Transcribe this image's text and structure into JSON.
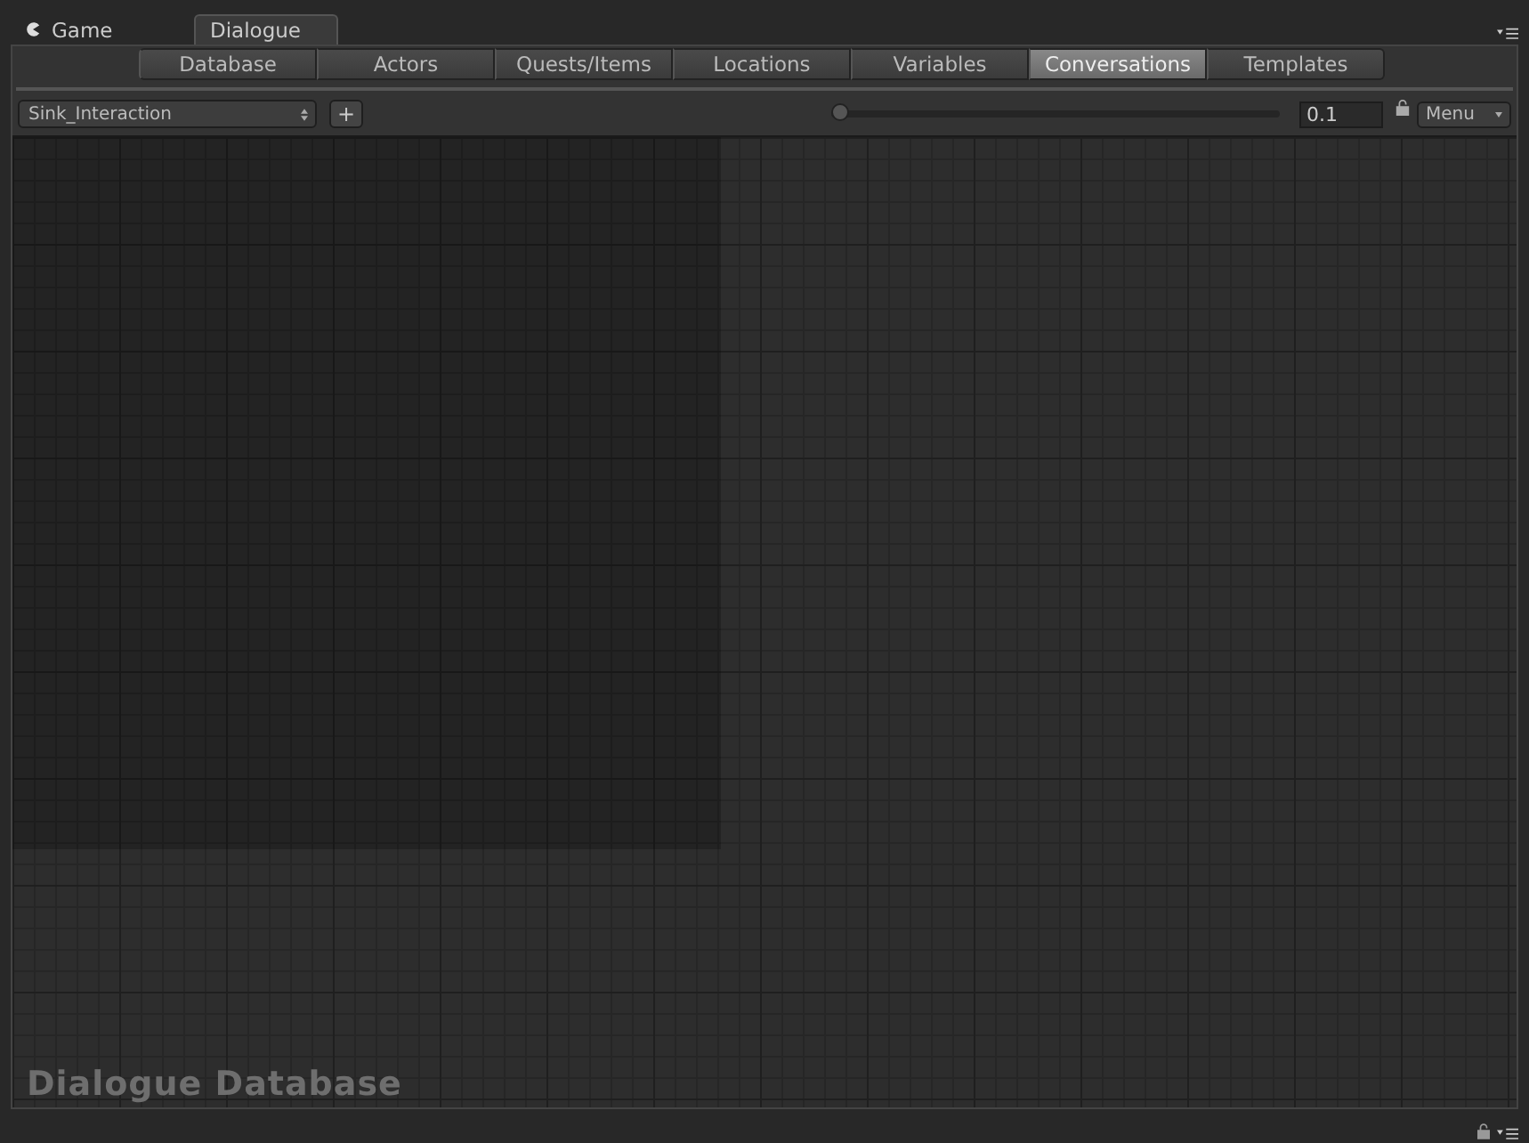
{
  "window_tabs": [
    {
      "label": "Game",
      "selected": false,
      "kind": "game"
    },
    {
      "label": "Dialogue",
      "selected": true,
      "kind": "plain"
    }
  ],
  "section_tabs": [
    {
      "label": "Database",
      "selected": false
    },
    {
      "label": "Actors",
      "selected": false
    },
    {
      "label": "Quests/Items",
      "selected": false
    },
    {
      "label": "Locations",
      "selected": false
    },
    {
      "label": "Variables",
      "selected": false
    },
    {
      "label": "Conversations",
      "selected": true
    },
    {
      "label": "Templates",
      "selected": false
    }
  ],
  "toolbar": {
    "conversation": "Sink_Interaction",
    "add_button": "+",
    "zoom": {
      "level": 0
    },
    "zoom_value": "0.1",
    "menu": "Menu"
  },
  "canvas": {
    "label": "Dialogue Database"
  }
}
